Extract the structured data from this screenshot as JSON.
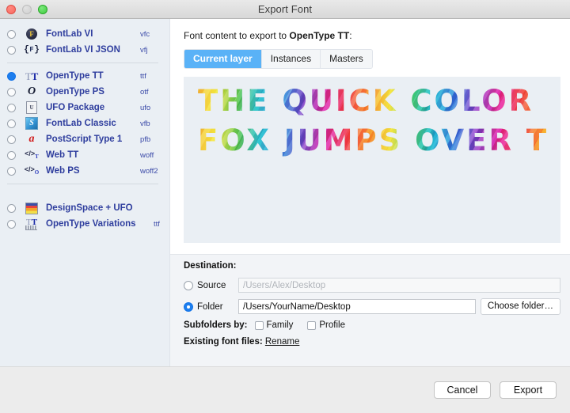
{
  "window": {
    "title": "Export Font",
    "traffic_lights": [
      {
        "name": "close-button",
        "color": "#f9675f"
      },
      {
        "name": "minimize-button",
        "color": "#cfcfcf"
      },
      {
        "name": "maximize-button",
        "color": "#3ecb3e"
      }
    ]
  },
  "sidebar": {
    "groups": [
      {
        "items": [
          {
            "label": "FontLab VI",
            "ext": "vfc",
            "icon": "fontlab-circle-icon",
            "selected": false
          },
          {
            "label": "FontLab VI JSON",
            "ext": "vfj",
            "icon": "fontlab-json-icon",
            "selected": false
          }
        ]
      },
      {
        "items": [
          {
            "label": "OpenType TT",
            "ext": "ttf",
            "icon": "opentype-tt-icon",
            "selected": true
          },
          {
            "label": "OpenType PS",
            "ext": "otf",
            "icon": "opentype-ps-icon",
            "selected": false
          },
          {
            "label": "UFO Package",
            "ext": "ufo",
            "icon": "ufo-package-icon",
            "selected": false
          },
          {
            "label": "FontLab Classic",
            "ext": "vfb",
            "icon": "fontlab-classic-icon",
            "selected": false
          },
          {
            "label": "PostScript Type 1",
            "ext": "pfb",
            "icon": "postscript-type1-icon",
            "selected": false
          },
          {
            "label": "Web TT",
            "ext": "woff",
            "icon": "web-tt-icon",
            "selected": false
          },
          {
            "label": "Web PS",
            "ext": "woff2",
            "icon": "web-ps-icon",
            "selected": false
          }
        ]
      },
      {
        "items": [
          {
            "label": "DesignSpace + UFO",
            "ext": "",
            "icon": "designspace-ufo-icon",
            "selected": false
          },
          {
            "label": "OpenType Variations",
            "ext": "ttf",
            "icon": "opentype-variations-icon",
            "selected": false
          }
        ]
      }
    ]
  },
  "main": {
    "content_label_prefix": "Font content to export to ",
    "content_label_format": "OpenType TT",
    "content_label_suffix": ":",
    "tabs": [
      {
        "label": "Current layer",
        "active": true
      },
      {
        "label": "Instances",
        "active": false
      },
      {
        "label": "Masters",
        "active": false
      }
    ],
    "preview": {
      "line1": "THE QUICK COLOR",
      "line2": "FOX JUMPS OVER T"
    }
  },
  "destination": {
    "title": "Destination:",
    "source": {
      "radio_label": "Source",
      "selected": false,
      "path_placeholder": "/Users/Alex/Desktop"
    },
    "folder": {
      "radio_label": "Folder",
      "selected": true,
      "path_value": "/Users/YourName/Desktop",
      "choose_button": "Choose folder…"
    },
    "subfolders": {
      "title": "Subfolders by:",
      "options": [
        {
          "label": "Family",
          "checked": false
        },
        {
          "label": "Profile",
          "checked": false
        }
      ]
    },
    "existing": {
      "label": "Existing font files:",
      "action": "Rename"
    }
  },
  "footer": {
    "cancel_label": "Cancel",
    "export_label": "Export"
  },
  "colors": {
    "accent_blue": "#1d7eee",
    "tab_active": "#5ab2f7",
    "sidebar_bg": "#eaeff4",
    "label_blue": "#2f3e9e"
  }
}
